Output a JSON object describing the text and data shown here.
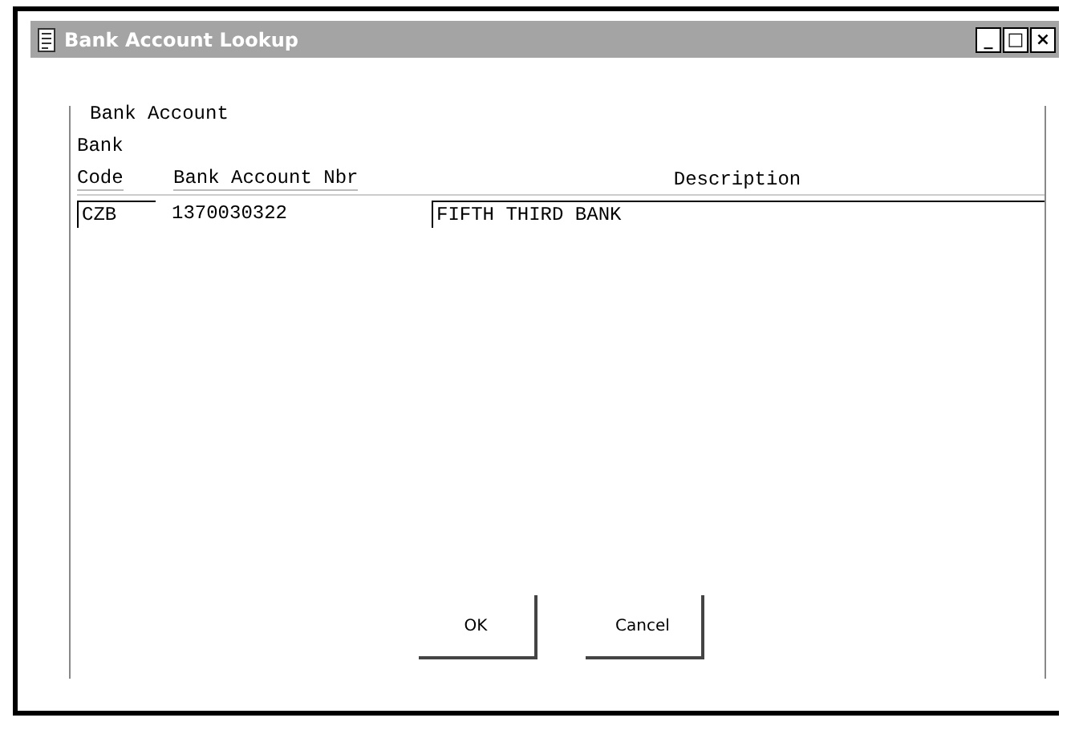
{
  "window": {
    "title": "Bank Account Lookup",
    "controls": [
      "_",
      "□",
      "×"
    ]
  },
  "group_label": "Bank Account",
  "columns": [
    {
      "line1": "Bank",
      "line2": "Code"
    },
    {
      "line2": "Bank Account Nbr"
    },
    {
      "line2": "Description"
    }
  ],
  "rows": [
    {
      "code": "CZB",
      "account": "1370030322",
      "description": "FIFTH THIRD BANK"
    }
  ],
  "buttons": [
    "OK",
    "Cancel"
  ]
}
